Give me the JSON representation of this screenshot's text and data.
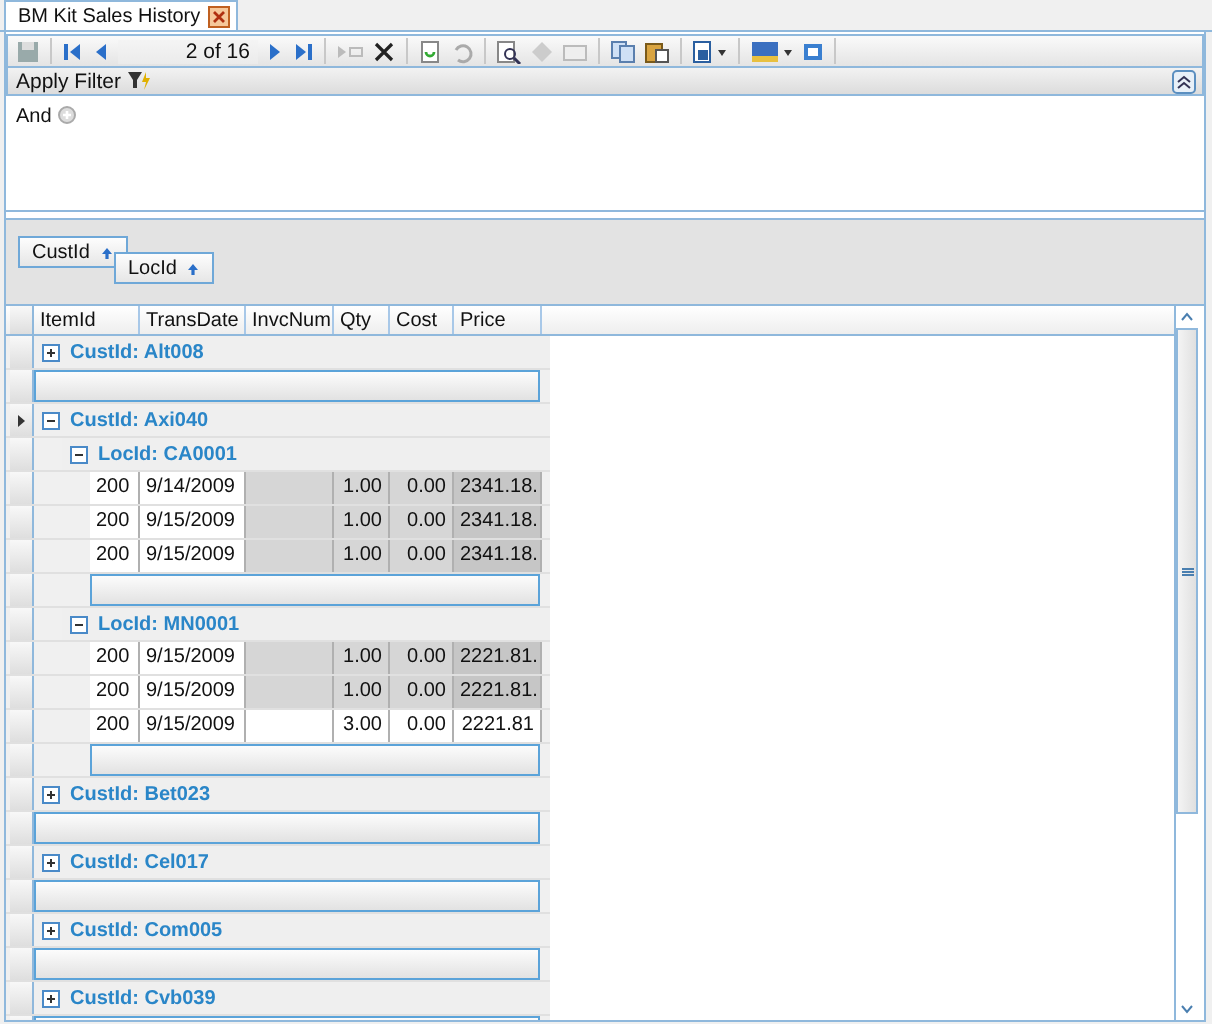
{
  "tab": {
    "title": "BM Kit Sales History",
    "selected": true
  },
  "navigator": {
    "position": "2 of 16"
  },
  "filter": {
    "title": "Apply Filter",
    "operator": "And"
  },
  "group_by": [
    {
      "label": "CustId"
    },
    {
      "label": "LocId"
    }
  ],
  "columns": [
    "ItemId",
    "TransDate",
    "InvcNum",
    "Qty",
    "Cost",
    "Price"
  ],
  "groups": [
    {
      "label": "CustId: Alt008",
      "expanded": false,
      "current": false
    },
    {
      "label": "CustId: Axi040",
      "expanded": true,
      "current": true,
      "children": [
        {
          "label": "LocId: CA0001",
          "expanded": true,
          "rows": [
            {
              "cells": [
                "200",
                "9/14/2009",
                "",
                "1.00",
                "0.00",
                "2341.18."
              ],
              "highlighted": true
            },
            {
              "cells": [
                "200",
                "9/15/2009",
                "",
                "1.00",
                "0.00",
                "2341.18."
              ],
              "highlighted": true
            },
            {
              "cells": [
                "200",
                "9/15/2009",
                "",
                "1.00",
                "0.00",
                "2341.18."
              ],
              "highlighted": true
            }
          ]
        },
        {
          "label": "LocId: MN0001",
          "expanded": true,
          "rows": [
            {
              "cells": [
                "200",
                "9/15/2009",
                "",
                "1.00",
                "0.00",
                "2221.81."
              ],
              "highlighted": true
            },
            {
              "cells": [
                "200",
                "9/15/2009",
                "",
                "1.00",
                "0.00",
                "2221.81."
              ],
              "highlighted": true
            },
            {
              "cells": [
                "200",
                "9/15/2009",
                "",
                "3.00",
                "0.00",
                "2221.81"
              ],
              "highlighted": false
            }
          ]
        }
      ]
    },
    {
      "label": "CustId: Bet023",
      "expanded": false,
      "current": false
    },
    {
      "label": "CustId: Cel017",
      "expanded": false,
      "current": false
    },
    {
      "label": "CustId: Com005",
      "expanded": false,
      "current": false
    },
    {
      "label": "CustId: Cvb039",
      "expanded": false,
      "current": false
    }
  ]
}
